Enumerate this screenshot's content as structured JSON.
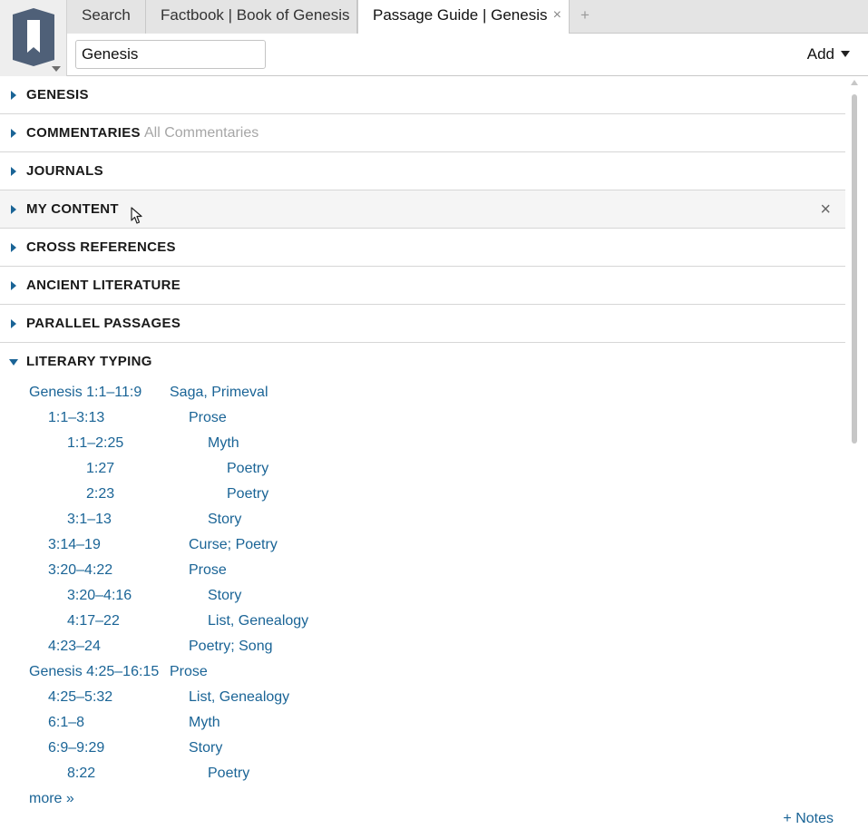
{
  "tabs": [
    {
      "label": "Search",
      "active": false
    },
    {
      "label": "Factbook | Book of Genesis",
      "active": false
    },
    {
      "label": "Passage Guide | Genesis",
      "active": true
    }
  ],
  "new_tab_glyph": "+",
  "close_glyph": "×",
  "toolbar": {
    "reference_value": "Genesis",
    "add_label": "Add"
  },
  "sections": [
    {
      "title": "GENESIS",
      "sub": ""
    },
    {
      "title": "COMMENTARIES",
      "sub": "All Commentaries"
    },
    {
      "title": "JOURNALS",
      "sub": ""
    },
    {
      "title": "MY CONTENT",
      "sub": ""
    },
    {
      "title": "CROSS REFERENCES",
      "sub": ""
    },
    {
      "title": "ANCIENT LITERATURE",
      "sub": ""
    },
    {
      "title": "PARALLEL PASSAGES",
      "sub": ""
    },
    {
      "title": "LITERARY TYPING",
      "sub": ""
    }
  ],
  "literary_typing": [
    {
      "ref": "Genesis 1:1–11:9",
      "type": "Saga, Primeval",
      "level": 0
    },
    {
      "ref": "1:1–3:13",
      "type": "Prose",
      "level": 1
    },
    {
      "ref": "1:1–2:25",
      "type": "Myth",
      "level": 2
    },
    {
      "ref": "1:27",
      "type": "Poetry",
      "level": 3
    },
    {
      "ref": "2:23",
      "type": "Poetry",
      "level": 3
    },
    {
      "ref": "3:1–13",
      "type": "Story",
      "level": 2
    },
    {
      "ref": "3:14–19",
      "type": "Curse; Poetry",
      "level": 1
    },
    {
      "ref": "3:20–4:22",
      "type": "Prose",
      "level": 1
    },
    {
      "ref": "3:20–4:16",
      "type": "Story",
      "level": 2
    },
    {
      "ref": "4:17–22",
      "type": "List, Genealogy",
      "level": 2
    },
    {
      "ref": "4:23–24",
      "type": "Poetry; Song",
      "level": 1
    },
    {
      "ref": "Genesis 4:25–16:15",
      "type": "Prose",
      "level": 0
    },
    {
      "ref": "4:25–5:32",
      "type": "List, Genealogy",
      "level": 1
    },
    {
      "ref": "6:1–8",
      "type": "Myth",
      "level": 1
    },
    {
      "ref": "6:9–9:29",
      "type": "Story",
      "level": 1
    },
    {
      "ref": "8:22",
      "type": "Poetry",
      "level": 2
    }
  ],
  "more_label": "more »",
  "notes_label": "+ Notes"
}
